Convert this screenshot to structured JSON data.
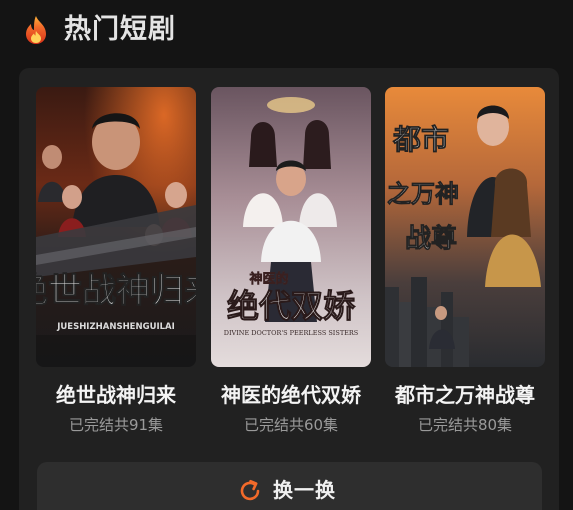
{
  "header": {
    "title": "热门短剧",
    "icon": "fire-icon"
  },
  "cards": [
    {
      "title": "绝世战神归来",
      "status": "已完结共91集",
      "poster_title": "绝世战神归来",
      "poster_subtitle": "JUESHIZHANSHENGUILAI"
    },
    {
      "title": "神医的绝代双娇",
      "status": "已完结共60集",
      "poster_title_top": "神医的",
      "poster_title_main": "绝代双娇",
      "poster_subtitle": "DIVINE DOCTOR'S PEERLESS SISTERS"
    },
    {
      "title": "都市之万神战尊",
      "status": "已完结共80集",
      "poster_title_a": "都市",
      "poster_title_b": "之万神",
      "poster_title_c": "战尊"
    }
  ],
  "refresh_button": {
    "label": "换一换",
    "icon": "refresh-icon"
  },
  "colors": {
    "background": "#141414",
    "panel": "#212121",
    "button": "#2e2e2e",
    "accent": "#f26a2a",
    "status_text": "#9a9a9a"
  }
}
